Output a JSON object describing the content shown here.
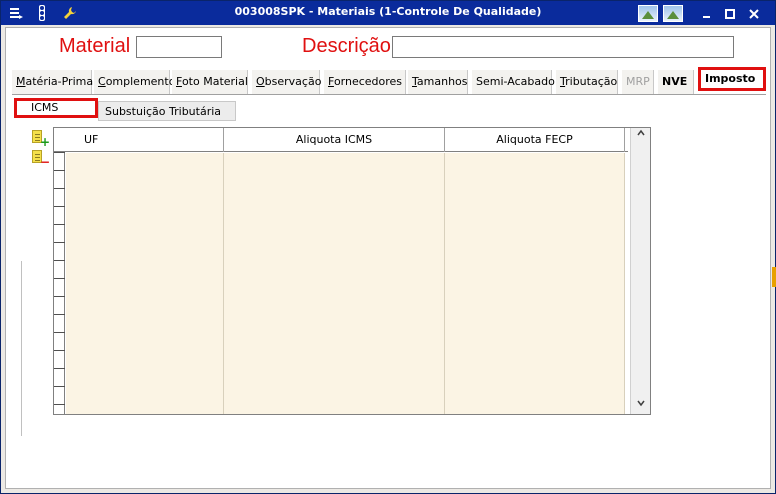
{
  "window": {
    "title": "003008SPK - Materiais (1-Controle De Qualidade)",
    "title_icons": [
      "menu-icon",
      "traffic-light-icon",
      "wrench-icon"
    ],
    "controls": [
      "image-icon",
      "image-icon",
      "minimize-icon",
      "maximize-icon",
      "close-icon"
    ]
  },
  "form": {
    "material_label": "Material",
    "material_value": "",
    "descricao_label": "Descrição",
    "descricao_value": ""
  },
  "tabs": [
    {
      "label": "Matéria-Prima"
    },
    {
      "label": "Complemento"
    },
    {
      "label": "Foto Material"
    },
    {
      "label": "Observação"
    },
    {
      "label": "Fornecedores"
    },
    {
      "label": "Tamanhos"
    },
    {
      "label": "Semi-Acabado"
    },
    {
      "label": "Tributação"
    },
    {
      "label": "MRP"
    },
    {
      "label": "NVE"
    },
    {
      "label": "Imposto"
    }
  ],
  "active_tab": "Imposto",
  "subtabs": [
    {
      "label": "ICMS"
    },
    {
      "label": "Substuição Tributária"
    }
  ],
  "active_subtab": "ICMS",
  "grid": {
    "columns": [
      "UF",
      "Aliquota ICMS",
      "Aliquota FECP"
    ],
    "rows": []
  },
  "side_actions": {
    "add": "add-row-icon",
    "remove": "remove-row-icon"
  },
  "colors": {
    "titlebar": "#0a2b9c",
    "highlight": "#e01010",
    "grid_bg": "#fbf4e4"
  }
}
